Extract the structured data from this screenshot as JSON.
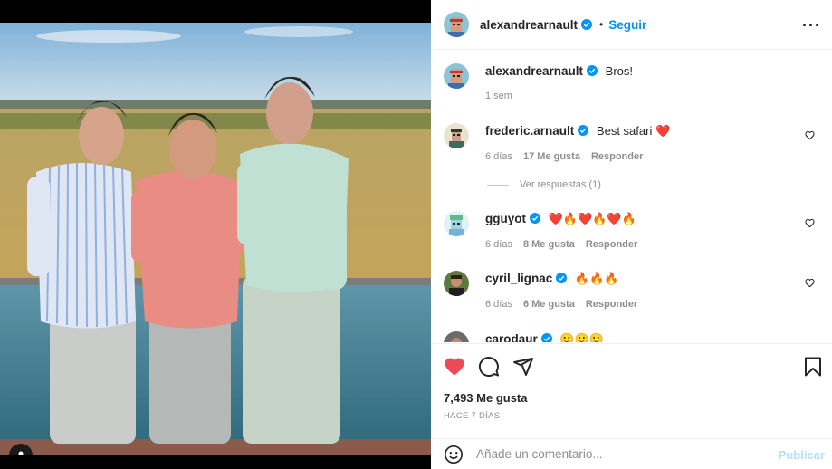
{
  "post": {
    "author": "alexandrearnault",
    "follow_label": "Seguir",
    "caption": "Bros!",
    "caption_time": "1 sem",
    "likes": "7,493 Me gusta",
    "time_ago": "HACE 7 DÍAS",
    "add_comment_placeholder": "Añade un comentario...",
    "publish_label": "Publicar"
  },
  "comments": [
    {
      "user": "frederic.arnault",
      "text": "Best safari ❤️",
      "time": "6 días",
      "likes": "17 Me gusta",
      "reply": "Responder",
      "replies_label": "Ver respuestas (1)"
    },
    {
      "user": "gguyot",
      "text": "❤️🔥❤️🔥❤️🔥",
      "time": "6 días",
      "likes": "8 Me gusta",
      "reply": "Responder"
    },
    {
      "user": "cyril_lignac",
      "text": "🔥🔥🔥",
      "time": "6 días",
      "likes": "6 Me gusta",
      "reply": "Responder"
    },
    {
      "user": "carodaur",
      "text": "🙂🙂🙂"
    }
  ],
  "icons": {
    "verified": "verified-badge-icon",
    "more": "more-options-icon",
    "like": "heart-filled-icon",
    "comment": "comment-icon",
    "share": "share-icon",
    "save": "bookmark-icon",
    "emoji": "emoji-icon",
    "tag": "user-tag-icon"
  },
  "colors": {
    "accent": "#0095f6",
    "like": "#ed4956",
    "publish_disabled": "#b2dffc"
  }
}
